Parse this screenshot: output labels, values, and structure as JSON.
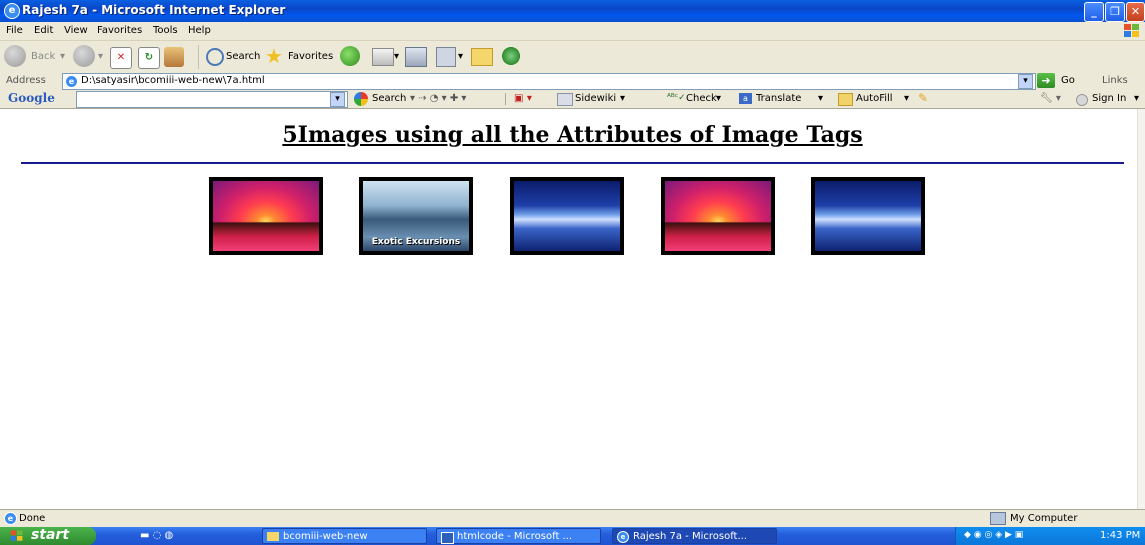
{
  "window": {
    "title": "Rajesh 7a - Microsoft Internet Explorer"
  },
  "menu": [
    "File",
    "Edit",
    "View",
    "Favorites",
    "Tools",
    "Help"
  ],
  "toolbar": {
    "back": "Back",
    "search": "Search",
    "favorites": "Favorites"
  },
  "address": {
    "label": "Address",
    "value": "D:\\satyasir\\bcomiii-web-new\\7a.html",
    "go": "Go",
    "links": "Links"
  },
  "google": {
    "logo": "Google",
    "search": "Search",
    "sidewiki": "Sidewiki",
    "check": "Check",
    "translate": "Translate",
    "autofill": "AutoFill",
    "sign_in": "Sign In"
  },
  "page": {
    "heading": "5Images using all the Attributes of Image Tags",
    "images": [
      {
        "kind": "sunset",
        "caption": "",
        "overlay": ""
      },
      {
        "kind": "snow",
        "caption": "Exotic Excursions",
        "overlay": ""
      },
      {
        "kind": "blue",
        "caption": "",
        "overlay": ""
      },
      {
        "kind": "sunset",
        "caption": "",
        "overlay": ""
      },
      {
        "kind": "blue",
        "caption": "",
        "overlay": ""
      }
    ]
  },
  "status": {
    "left": "Done",
    "zone": "My Computer"
  },
  "taskbar": {
    "start": "start",
    "tasks": [
      "bcomiii-web-new",
      "htmlcode - Microsoft ...",
      "Rajesh 7a - Microsoft..."
    ],
    "clock": "1:43 PM"
  }
}
